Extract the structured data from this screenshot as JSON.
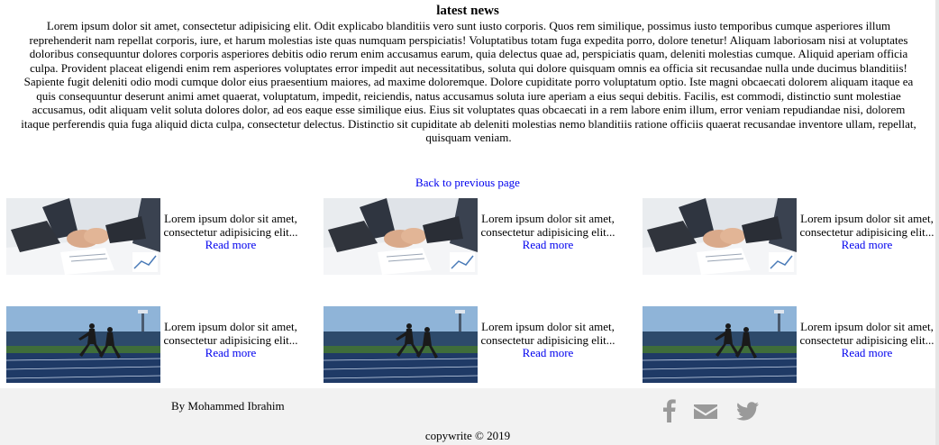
{
  "article": {
    "title": "latest news",
    "body": "Lorem ipsum dolor sit amet, consectetur adipisicing elit. Odit explicabo blanditiis vero sunt iusto corporis. Quos rem similique, possimus iusto temporibus cumque asperiores illum reprehenderit nam repellat corporis, iure, et harum molestias iste quas numquam perspiciatis! Voluptatibus totam fuga expedita porro, dolore tenetur! Aliquam laboriosam nisi at voluptates doloribus consequuntur dolores corporis asperiores debitis odio rerum enim accusamus earum, quia delectus quae ad, perspiciatis quam, deleniti molestias cumque. Aliquid aperiam officia culpa. Provident placeat eligendi enim rem asperiores voluptates error impedit aut necessitatibus, soluta qui dolore quisquam omnis ea officia sit recusandae nulla unde ducimus blanditiis! Sapiente fugit deleniti odio modi cumque dolor eius praesentium maiores, ad maxime doloremque. Dolore cupiditate porro voluptatum optio. Iste magni obcaecati dolorem aliquam itaque ea quis consequuntur deserunt animi amet quaerat, voluptatum, impedit, reiciendis, natus accusamus soluta iure aperiam a eius sequi debitis. Facilis, est commodi, distinctio sunt molestiae accusamus, odit aliquam velit soluta dolores dolor, ad eos eaque esse similique eius. Eius sit voluptates quas obcaecati in a rem labore enim illum, error veniam repudiandae nisi, dolorem itaque perferendis quia fuga aliquid dicta culpa, consectetur delectus. Distinctio sit cupiditate ab deleniti molestias nemo blanditiis ratione officiis quaerat recusandae inventore ullam, repellat, quisquam veniam.",
    "back_link": "Back to previous page"
  },
  "cards": [
    {
      "excerpt": "Lorem ipsum dolor sit amet, consectetur adipisicing elit...",
      "read_more": "Read more",
      "image": "business-handshake-image"
    },
    {
      "excerpt": "Lorem ipsum dolor sit amet, consectetur adipisicing elit...",
      "read_more": "Read more",
      "image": "business-handshake-image"
    },
    {
      "excerpt": "Lorem ipsum dolor sit amet, consectetur adipisicing elit...",
      "read_more": "Read more",
      "image": "business-handshake-image"
    },
    {
      "excerpt": "Lorem ipsum dolor sit amet, consectetur adipisicing elit...",
      "read_more": "Read more",
      "image": "runners-track-image"
    },
    {
      "excerpt": "Lorem ipsum dolor sit amet, consectetur adipisicing elit...",
      "read_more": "Read more",
      "image": "runners-track-image"
    },
    {
      "excerpt": "Lorem ipsum dolor sit amet, consectetur adipisicing elit...",
      "read_more": "Read more",
      "image": "runners-track-image"
    }
  ],
  "footer": {
    "author": "By Mohammed Ibrahim",
    "copyright": "copywrite © 2019",
    "social_icons": [
      "facebook-icon",
      "mail-icon",
      "twitter-icon"
    ],
    "icon_color": "#9a9a9a",
    "background": "#f2f2f2"
  },
  "colors": {
    "link": "#0000ee",
    "text": "#000000"
  }
}
